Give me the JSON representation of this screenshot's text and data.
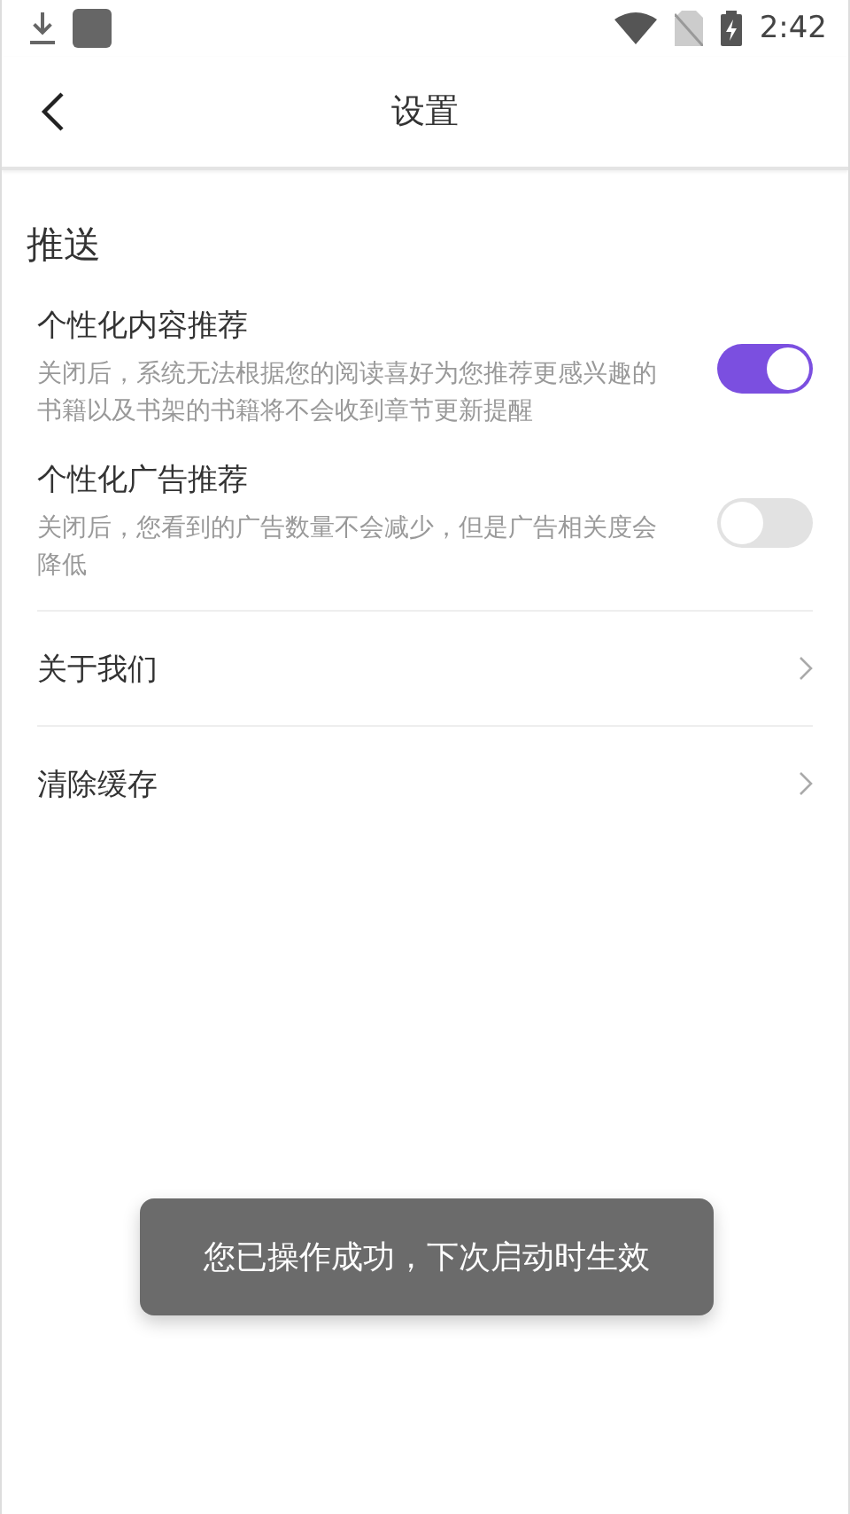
{
  "status_bar": {
    "time": "2:42"
  },
  "header": {
    "title": "设置"
  },
  "section": {
    "title": "推送"
  },
  "toggles": [
    {
      "label": "个性化内容推荐",
      "description": "关闭后，系统无法根据您的阅读喜好为您推荐更感兴趣的书籍以及书架的书籍将不会收到章节更新提醒",
      "on": true
    },
    {
      "label": "个性化广告推荐",
      "description": "关闭后，您看到的广告数量不会减少，但是广告相关度会降低",
      "on": false
    }
  ],
  "links": [
    {
      "label": "关于我们"
    },
    {
      "label": "清除缓存"
    }
  ],
  "toast": {
    "text": "您已操作成功，下次启动时生效"
  }
}
